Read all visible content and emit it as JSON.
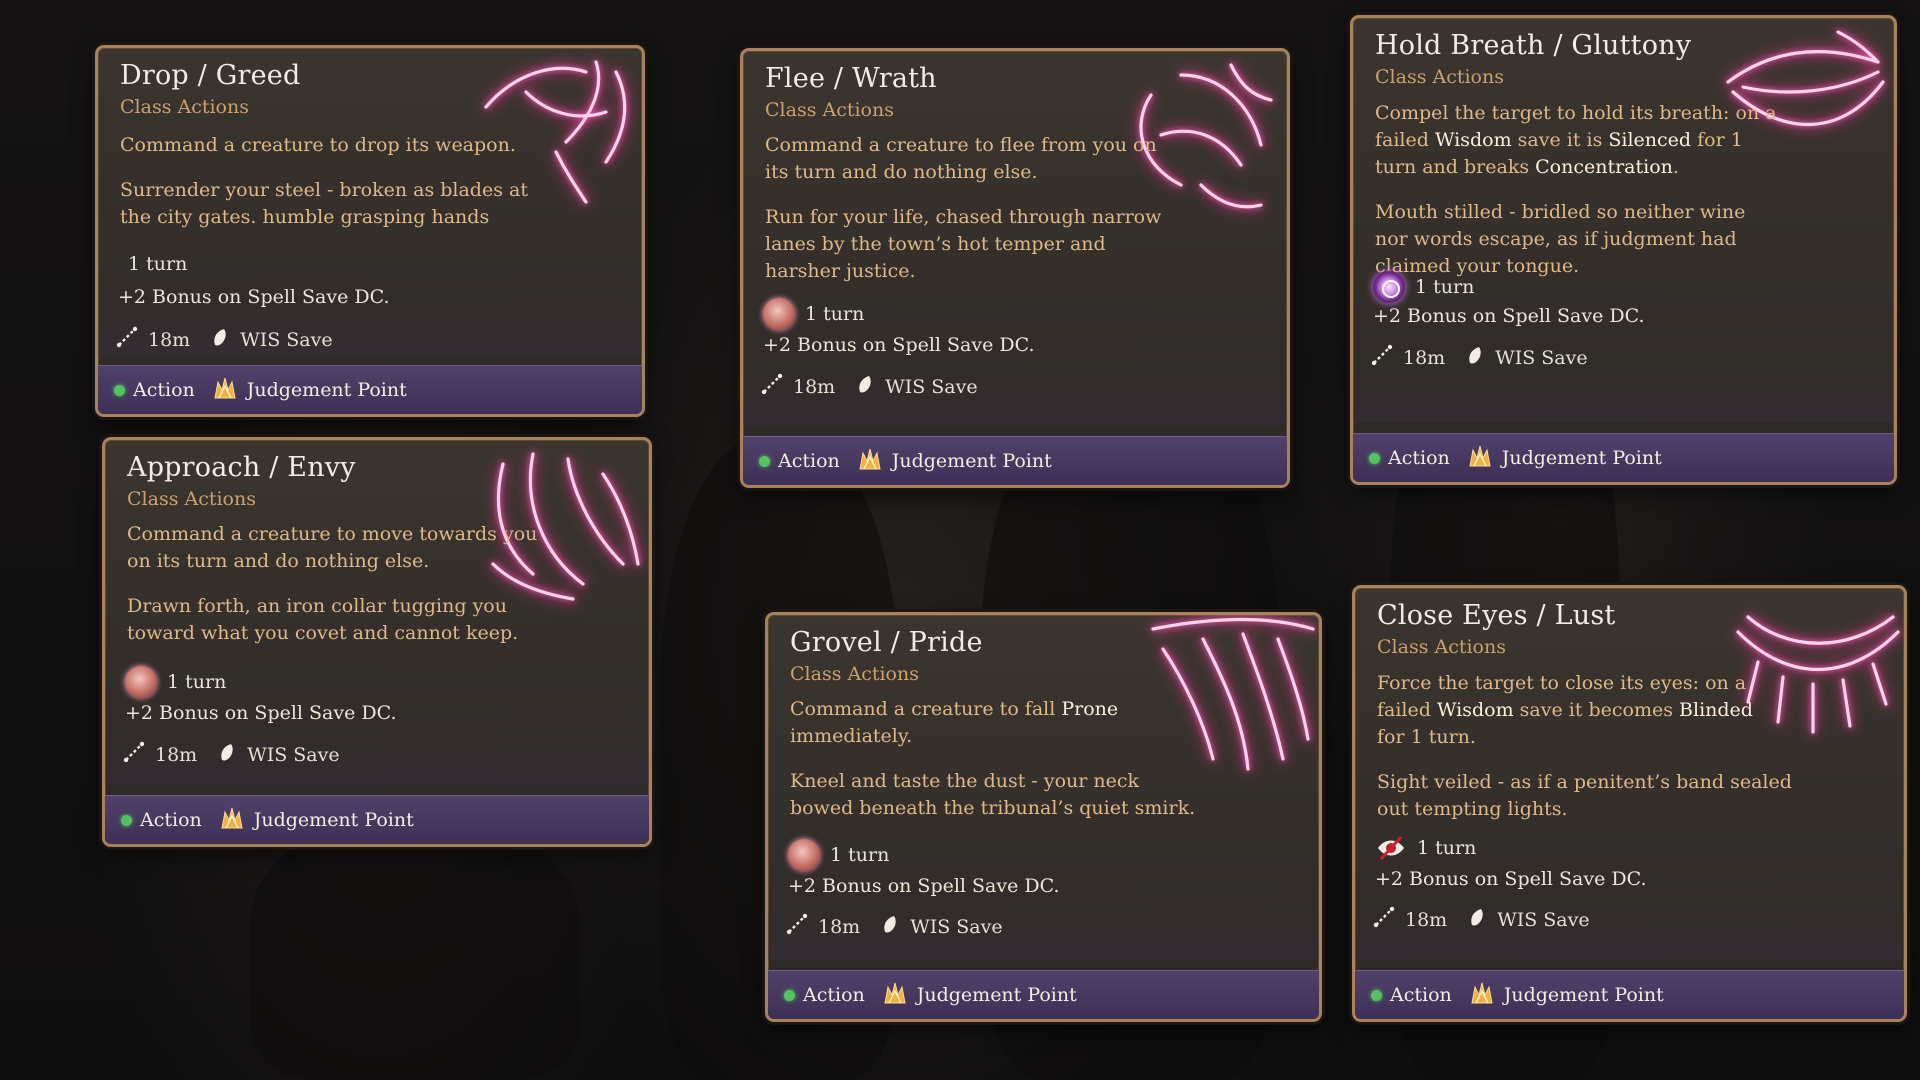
{
  "cards": [
    {
      "title": "Drop / Greed",
      "subtitle": "Class Actions",
      "desc": [
        "Command a creature to drop its weapon."
      ],
      "lore": [
        "Surrender your steel - broken as blades at",
        "the city gates. humble grasping hands"
      ],
      "duration": "1 turn",
      "duration_icon": "none",
      "bonus": "+2 Bonus on Spell Save DC.",
      "range": "18m",
      "save": "WIS Save",
      "action": "Action",
      "resource": "Judgement Point",
      "glow_icon": "pointing-hand-icon"
    },
    {
      "title": "Approach / Envy",
      "subtitle": "Class Actions",
      "desc": [
        "Command a creature to move towards you",
        "on its turn and do nothing else."
      ],
      "lore": [
        "Drawn forth, an iron collar tugging you",
        "toward what you covet and cannot keep."
      ],
      "duration": "1 turn",
      "duration_icon": "grasping-hand-icon",
      "bonus": "+2 Bonus on Spell Save DC.",
      "range": "18m",
      "save": "WIS Save",
      "action": "Action",
      "resource": "Judgement Point",
      "glow_icon": "clawed-hand-icon"
    },
    {
      "title": "Flee / Wrath",
      "subtitle": "Class Actions",
      "desc": [
        "Command a creature to flee from you on",
        "its turn and do nothing else."
      ],
      "lore": [
        "Run for your life, chased through narrow",
        "lanes by the town’s hot temper and",
        "harsher justice."
      ],
      "duration": "1 turn",
      "duration_icon": "fist-icon",
      "bonus": "+2 Bonus on Spell Save DC.",
      "range": "18m",
      "save": "WIS Save",
      "action": "Action",
      "resource": "Judgement Point",
      "glow_icon": "clenched-fist-icon"
    },
    {
      "title": "Grovel / Pride",
      "subtitle": "Class Actions",
      "desc": [
        "Command a creature to fall |Prone|",
        "immediately."
      ],
      "lore": [
        "Kneel and taste the dust - your neck",
        "bowed beneath the tribunal’s quiet smirk."
      ],
      "duration": "1 turn",
      "duration_icon": "grasping-hand-icon",
      "bonus": "+2 Bonus on Spell Save DC.",
      "range": "18m",
      "save": "WIS Save",
      "action": "Action",
      "resource": "Judgement Point",
      "glow_icon": "downward-hand-icon"
    },
    {
      "title": "Hold Breath / Gluttony",
      "subtitle": "Class Actions",
      "desc": [
        "Compel the target to hold its breath: on a",
        "failed |Wisdom| save it is |Silenced| for 1",
        "turn  and breaks |Concentration|."
      ],
      "lore": [
        "Mouth stilled - bridled so neither wine",
        "nor words escape, as if judgment had",
        "claimed your tongue."
      ],
      "duration": "1 turn",
      "duration_icon": "silence-ring-icon",
      "bonus": "+2 Bonus on Spell Save DC.",
      "range": "18m",
      "save": "WIS Save",
      "action": "Action",
      "resource": "Judgement Point",
      "glow_icon": "lips-icon"
    },
    {
      "title": "Close Eyes / Lust",
      "subtitle": "Class Actions",
      "desc": [
        "Force the target to close its eyes: on a",
        "failed |Wisdom| save it becomes |Blinded|",
        "for 1 turn."
      ],
      "lore": [
        "Sight veiled - as if a penitent’s band sealed",
        "out tempting lights."
      ],
      "duration": "1 turn",
      "duration_icon": "blinded-eye-icon",
      "bonus": "+2 Bonus on Spell Save DC.",
      "range": "18m",
      "save": "WIS Save",
      "action": "Action",
      "resource": "Judgement Point",
      "glow_icon": "closed-eye-icon"
    }
  ],
  "colors": {
    "card_bg": "#37312c",
    "border": "#a8835a",
    "subtitle": "#cba16c",
    "body_text": "#dfb987",
    "footer_bg": "#473860",
    "action_dot": "#52c35f",
    "glow": "#ff6ec7"
  }
}
